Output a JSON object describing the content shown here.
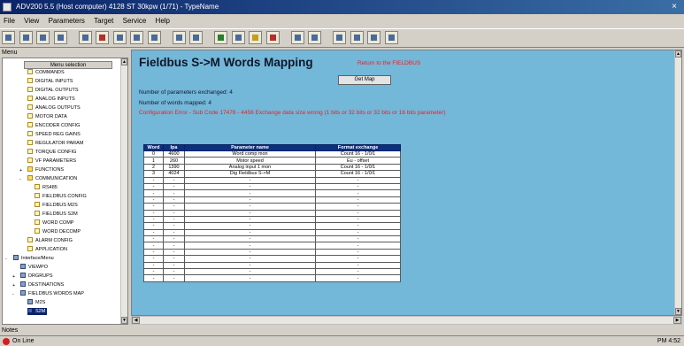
{
  "window": {
    "title": "ADV200 5.5 (Host computer) 4128 ST 30kpw (1/71) - TypeName",
    "close_glyph": "×"
  },
  "menu": [
    "File",
    "View",
    "Parameters",
    "Target",
    "Service",
    "Help"
  ],
  "sidebar": {
    "panel_label": "Menu",
    "header": "Menu selection",
    "items": [
      {
        "label": "COMMANDS"
      },
      {
        "label": "DIGITAL INPUTS"
      },
      {
        "label": "DIGITAL OUTPUTS"
      },
      {
        "label": "ANALOG INPUTS"
      },
      {
        "label": "ANALOG OUTPUTS"
      },
      {
        "label": "MOTOR DATA"
      },
      {
        "label": "ENCODER CONFIG"
      },
      {
        "label": "SPEED REG GAINS"
      },
      {
        "label": "REGULATOR PARAM"
      },
      {
        "label": "TORQUE CONFIG"
      },
      {
        "label": "VF PARAMETERS"
      },
      {
        "label": "FUNCTIONS"
      },
      {
        "label": "COMMUNICATION"
      },
      {
        "label": "RS485"
      },
      {
        "label": "FIELDBUS CONFIG"
      },
      {
        "label": "FIELDBUS M2S"
      },
      {
        "label": "FIELDBUS S2M"
      },
      {
        "label": "WORD COMP"
      },
      {
        "label": "WORD DECOMP"
      },
      {
        "label": "ALARM CONFIG"
      },
      {
        "label": "APPLICATION"
      },
      {
        "label": "Interface/Menu"
      },
      {
        "label": "VIEWPO"
      },
      {
        "label": "DRGRUPS"
      },
      {
        "label": "DESTINATIONS"
      },
      {
        "label": "FIELDBUS WORDS MAP"
      },
      {
        "label": "M2S"
      },
      {
        "label": "S2M"
      }
    ]
  },
  "page": {
    "title": "Fieldbus S->M Words Mapping",
    "link_label": "Return to the FIELDBUS",
    "save_button": "Get Map",
    "params_exchanged": "Number of parameters exchanged: 4",
    "words_mapped": "Number of words mapped: 4",
    "error": "Configuration Error - Sub Code 17476 - 4456 Exchange data size wrong (1 bits or 32 bits or 32 bits or 16 bits parameter)"
  },
  "table": {
    "columns": [
      "Word",
      "Ipa",
      "Parameter name",
      "Format exchange"
    ],
    "rows": [
      [
        "0",
        "4600",
        "Word comp mon",
        "Count 16 - 1/0/1"
      ],
      [
        "1",
        "260",
        "Motor speed",
        "Eu - offset"
      ],
      [
        "2",
        "1390",
        "Analog input 1 mon",
        "Count 16 - 1/0/1"
      ],
      [
        "3",
        "4024",
        "Dig Fieldbus S->M",
        "Count 16 - 1/0/1"
      ],
      [
        "-",
        "-",
        "-",
        "-"
      ],
      [
        "-",
        "-",
        "-",
        "-"
      ],
      [
        "-",
        "-",
        "-",
        "-"
      ],
      [
        "-",
        "-",
        "-",
        "-"
      ],
      [
        "-",
        "-",
        "-",
        "-"
      ],
      [
        "-",
        "-",
        "-",
        "-"
      ],
      [
        "-",
        "-",
        "-",
        "-"
      ],
      [
        "-",
        "-",
        "-",
        "-"
      ],
      [
        "-",
        "-",
        "-",
        "-"
      ],
      [
        "-",
        "-",
        "-",
        "-"
      ],
      [
        "-",
        "-",
        "-",
        "-"
      ],
      [
        "-",
        "-",
        "-",
        "-"
      ],
      [
        "-",
        "-",
        "-",
        "-"
      ],
      [
        "-",
        "-",
        "-",
        "-"
      ],
      [
        "-",
        "-",
        "-",
        "-"
      ],
      [
        "-",
        "-",
        "-",
        "-"
      ]
    ]
  },
  "status": {
    "label": "Notes",
    "text": "On Line",
    "right": "PM 4:52"
  },
  "colors": {
    "content_bg": "#73b7d9",
    "table_header": "#0a3080",
    "error": "#ee2020"
  }
}
